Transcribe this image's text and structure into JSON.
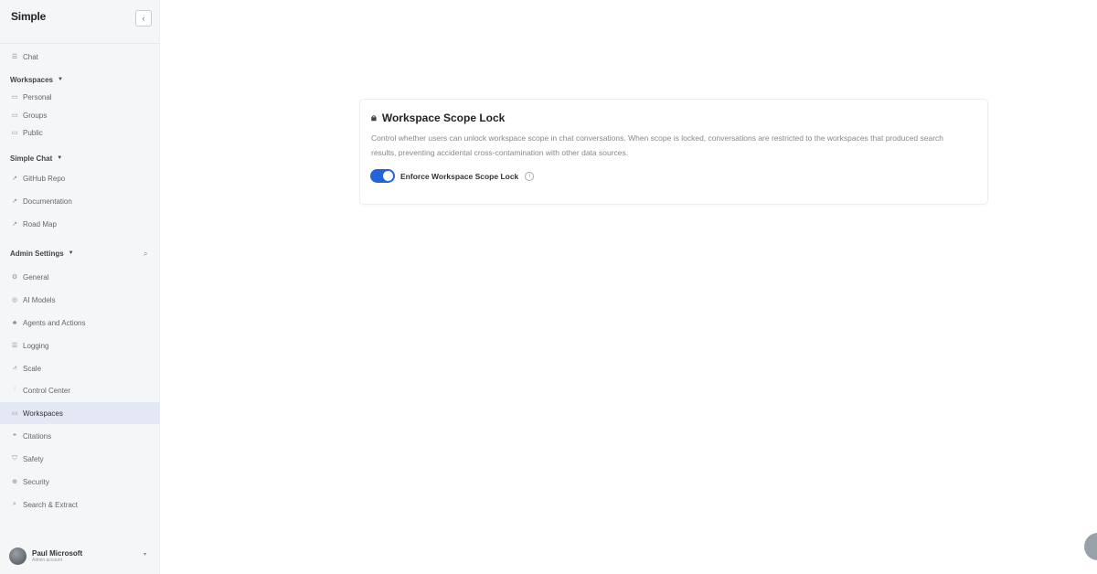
{
  "brand": {
    "name": "Simple",
    "sub": ""
  },
  "sidebar": {
    "collapse_label": "‹",
    "chat": {
      "label": "Chat",
      "icon": "chat-icon"
    },
    "workspaces": {
      "heading": "Workspaces",
      "items": [
        {
          "label": "Personal",
          "icon": "folder-icon"
        },
        {
          "label": "Groups",
          "icon": "folder-icon"
        },
        {
          "label": "Public",
          "icon": "folder-icon"
        }
      ]
    },
    "simple_chat": {
      "heading": "Simple Chat",
      "items": [
        {
          "label": "GitHub Repo",
          "icon": "external-link-icon"
        },
        {
          "label": "Documentation",
          "icon": "external-link-icon"
        },
        {
          "label": "Road Map",
          "icon": "external-link-icon"
        }
      ]
    },
    "admin": {
      "heading": "Admin Settings",
      "items": [
        {
          "label": "General",
          "icon": "gear-icon"
        },
        {
          "label": "AI Models",
          "icon": "cpu-icon"
        },
        {
          "label": "Agents and Actions",
          "icon": "agent-icon"
        },
        {
          "label": "Logging",
          "icon": "log-icon"
        },
        {
          "label": "Scale",
          "icon": "scale-icon"
        },
        {
          "label": "Control Center",
          "icon": "control-icon"
        },
        {
          "label": "Workspaces",
          "icon": "folder-icon",
          "active": true
        },
        {
          "label": "Citations",
          "icon": "quote-icon"
        },
        {
          "label": "Safety",
          "icon": "shield-icon"
        },
        {
          "label": "Security",
          "icon": "lock-icon"
        },
        {
          "label": "Search & Extract",
          "icon": "search-icon"
        }
      ]
    }
  },
  "user": {
    "name": "Paul Microsoft",
    "role": "Admin account"
  },
  "card": {
    "title": "Workspace Scope Lock",
    "description": "Control whether users can unlock workspace scope in chat conversations. When scope is locked, conversations are restricted to the workspaces that produced search results, preventing accidental cross-contamination with other data sources.",
    "toggle_label": "Enforce Workspace Scope Lock",
    "toggle_on": true
  },
  "colors": {
    "accent": "#2563d9",
    "active_bg": "#e3e8f4",
    "sidebar_bg": "#f5f6f8"
  }
}
